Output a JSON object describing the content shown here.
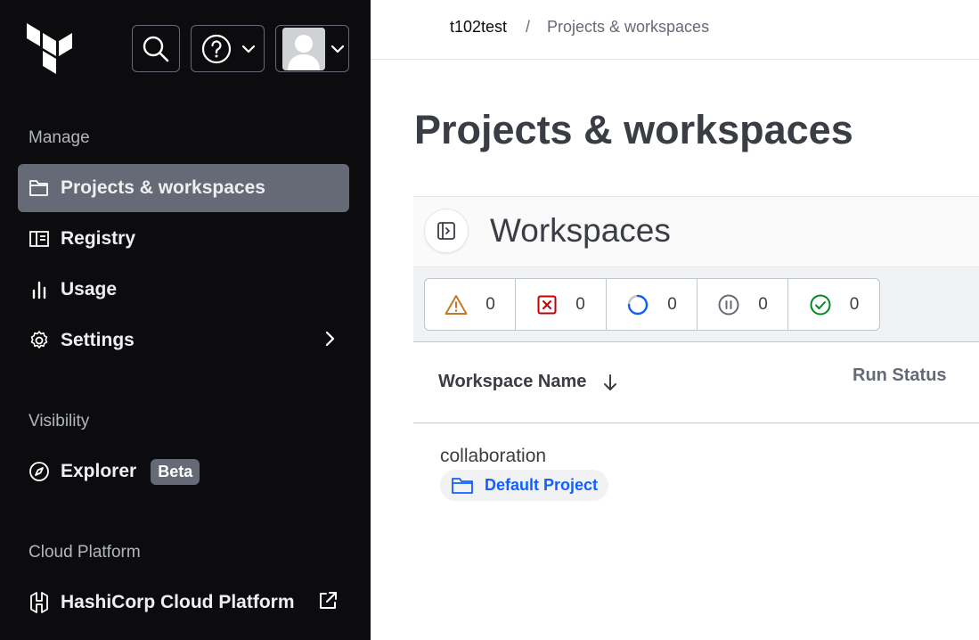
{
  "sidebar": {
    "sections": {
      "manage": "Manage",
      "visibility": "Visibility",
      "cloud_platform": "Cloud Platform"
    },
    "items": [
      {
        "label": "Projects & workspaces",
        "icon": "folder-icon",
        "active": true
      },
      {
        "label": "Registry",
        "icon": "registry-icon"
      },
      {
        "label": "Usage",
        "icon": "bar-chart-icon"
      },
      {
        "label": "Settings",
        "icon": "gear-icon"
      },
      {
        "label": "Explorer",
        "icon": "compass-icon",
        "badge": "Beta"
      },
      {
        "label": "HashiCorp Cloud Platform",
        "icon": "hashicorp-icon"
      }
    ]
  },
  "breadcrumb": {
    "org": "t102test",
    "separator": "/",
    "page": "Projects & workspaces"
  },
  "page_title": "Projects & workspaces",
  "workspaces": {
    "title": "Workspaces",
    "filters": [
      {
        "icon": "warning-icon",
        "count": "0",
        "color": "#c7792a"
      },
      {
        "icon": "error-icon",
        "count": "0",
        "color": "#c00005"
      },
      {
        "icon": "running-icon",
        "count": "0",
        "color": "#1060ff"
      },
      {
        "icon": "paused-icon",
        "count": "0",
        "color": "#656a76"
      },
      {
        "icon": "check-circle-icon",
        "count": "0",
        "color": "#008a22"
      }
    ],
    "columns": {
      "name": "Workspace Name",
      "status": "Run Status"
    },
    "rows": [
      {
        "name": "collaboration",
        "project": "Default Project"
      }
    ]
  },
  "colors": {
    "sidebar_bg": "#0c0c0e",
    "active_item": "#656a76",
    "link": "#1060ff"
  }
}
